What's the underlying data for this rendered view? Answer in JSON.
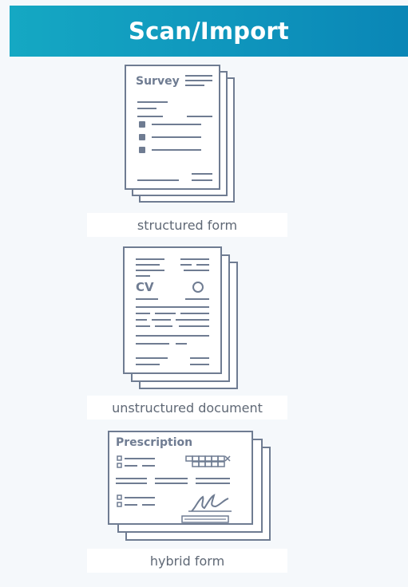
{
  "header": {
    "title": "Scan/Import"
  },
  "items": [
    {
      "label": "structured form",
      "doc_title": "Survey"
    },
    {
      "label": "unstructured document",
      "doc_title": "CV"
    },
    {
      "label": "hybrid form",
      "doc_title": "Prescription"
    }
  ],
  "colors": {
    "header_gradient": [
      "#15a8c3",
      "#0a86b6"
    ],
    "doc_stroke": "#6f7c92",
    "doc_fill": "#ffffff",
    "background": "#f5f8fb"
  },
  "icons": [
    "survey-document-icon",
    "cv-document-icon",
    "prescription-document-icon",
    "signature-icon",
    "envelope-icon"
  ]
}
